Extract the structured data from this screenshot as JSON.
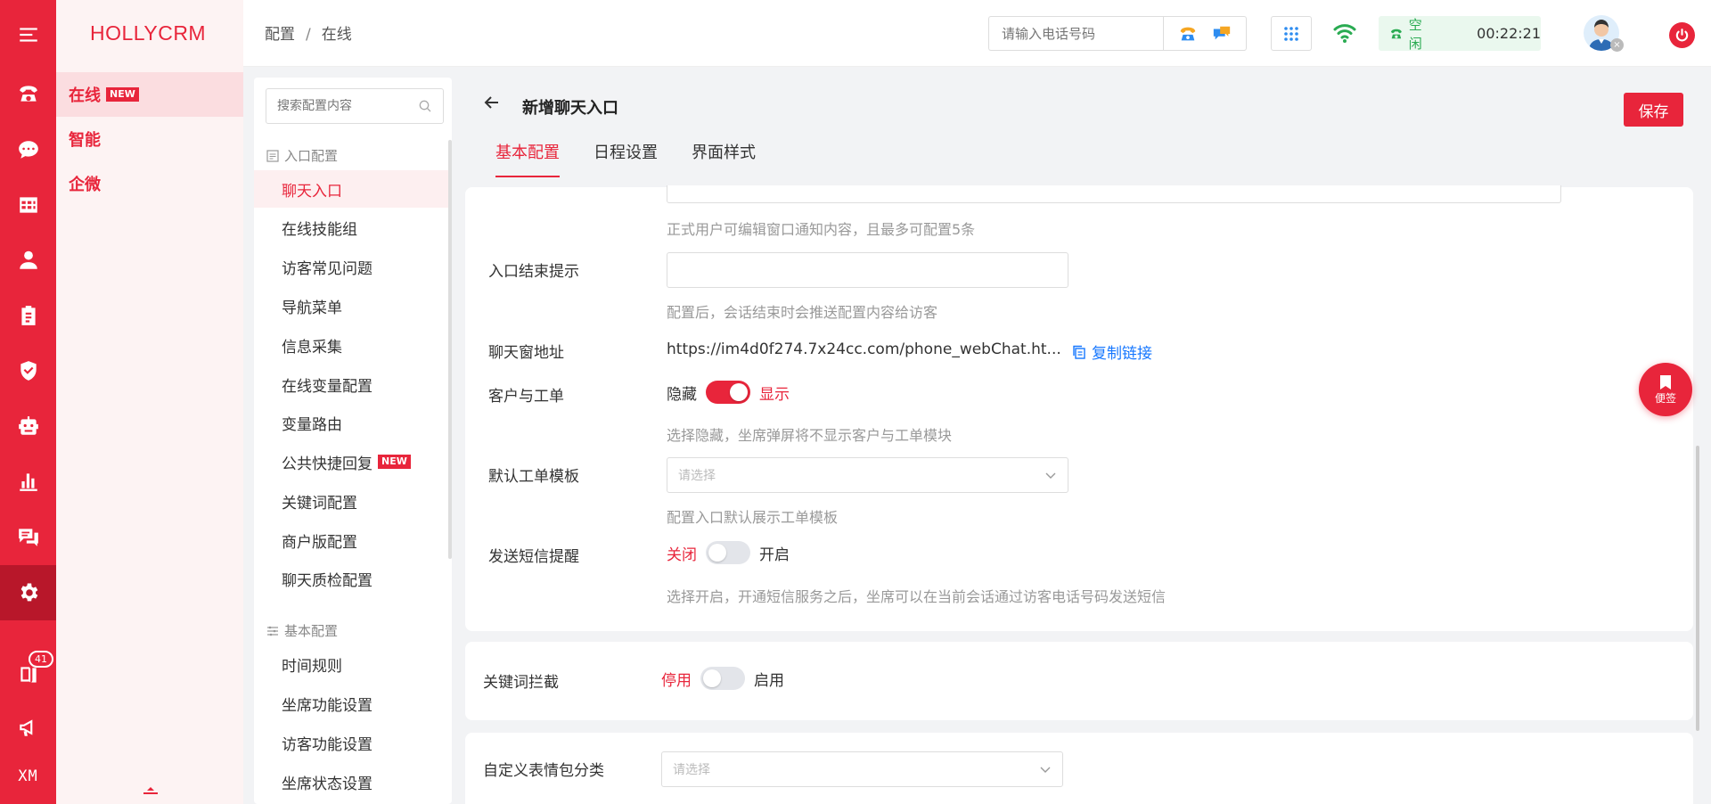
{
  "app": {
    "brand": "HOLLYCRM"
  },
  "rail": {
    "badge_count": "41",
    "bottom_text": "XM",
    "icons": [
      "menu-icon",
      "phone-icon",
      "chat-icon",
      "table-icon",
      "user-icon",
      "clipboard-icon",
      "shield-icon",
      "robot-icon",
      "bar-chart-icon",
      "message-icon",
      "gear-icon",
      "book-icon",
      "megaphone-icon"
    ]
  },
  "modules": {
    "items": [
      {
        "label": "在线",
        "tag": "NEW"
      },
      {
        "label": "智能"
      },
      {
        "label": "企微"
      }
    ]
  },
  "header": {
    "breadcrumb": [
      "配置",
      "在线"
    ],
    "breadcrumb_sep": "/",
    "phone_placeholder": "请输入电话号码",
    "status": "空闲",
    "timer": "00:22:21"
  },
  "config_menu": {
    "search_placeholder": "搜索配置内容",
    "group1": "入口配置",
    "items1": [
      "聊天入口",
      "在线技能组",
      "访客常见问题",
      "导航菜单",
      "信息采集",
      "在线变量配置",
      "变量路由",
      "公共快捷回复",
      "关键词配置",
      "商户版配置",
      "聊天质检配置"
    ],
    "new_tag": "NEW",
    "group2": "基本配置",
    "items2": [
      "时间规则",
      "坐席功能设置",
      "访客功能设置",
      "坐席状态设置"
    ]
  },
  "page": {
    "title": "新增聊天入口",
    "save": "保存",
    "tabs": [
      "基本配置",
      "日程设置",
      "界面样式"
    ]
  },
  "form": {
    "notice_hint": "正式用户可编辑窗口通知内容，且最多可配置5条",
    "end_tip_label": "入口结束提示",
    "end_tip_hint": "配置后，会话结束时会推送配置内容给访客",
    "chat_url_label": "聊天窗地址",
    "chat_url": "https://im4d0f274.7x24cc.com/phone_webChat.ht...",
    "copy_link": "复制链接",
    "customer_label": "客户与工单",
    "customer_off": "隐藏",
    "customer_on": "显示",
    "customer_hint": "选择隐藏，坐席弹屏将不显示客户与工单模块",
    "template_label": "默认工单模板",
    "template_placeholder": "请选择",
    "template_hint": "配置入口默认展示工单模板",
    "sms_label": "发送短信提醒",
    "sms_off": "关闭",
    "sms_on": "开启",
    "sms_hint": "选择开启，开通短信服务之后，坐席可以在当前会话通过访客电话号码发送短信",
    "keyword_label": "关键词拦截",
    "keyword_off": "停用",
    "keyword_on": "启用",
    "emoji_label": "自定义表情包分类",
    "emoji_placeholder": "请选择"
  },
  "float": {
    "label": "便签"
  },
  "colors": {
    "primary": "#e8253b",
    "link": "#1677ff",
    "status_green": "#2aab52"
  }
}
